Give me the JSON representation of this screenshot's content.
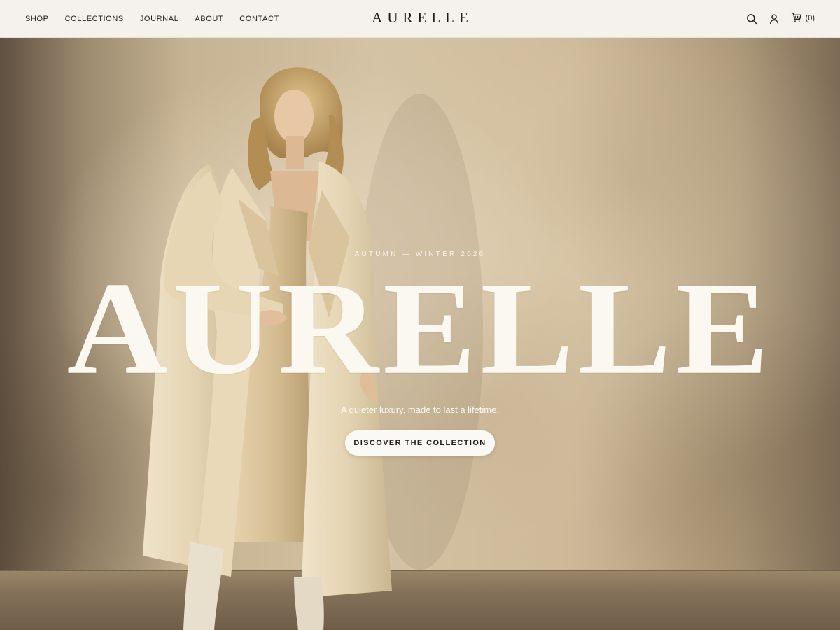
{
  "nav": {
    "links": [
      "SHOP",
      "COLLECTIONS",
      "JOURNAL",
      "ABOUT",
      "CONTACT"
    ],
    "brand": "AURELLE",
    "cart_count": "(0)",
    "icons": [
      "search-icon",
      "account-icon",
      "cart-icon"
    ]
  },
  "hero": {
    "eyebrow": "AUTUMN — WINTER 2026",
    "wordmark": "AURELLE",
    "tagline": "A quieter luxury, made to last a lifetime.",
    "cta_label": "DISCOVER THE COLLECTION"
  },
  "colors": {
    "nav_background": "#f5f2ed",
    "text_dark": "#1e1b17",
    "hero_text": "#fbf8f2",
    "button_background": "#fbf9f5",
    "wall": "#d4c2a4"
  }
}
